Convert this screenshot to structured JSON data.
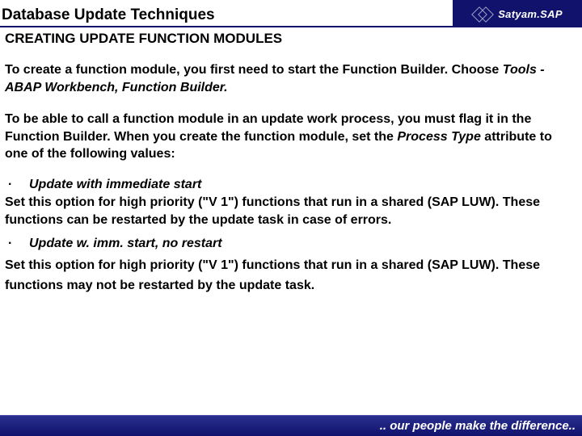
{
  "header": {
    "title": "Database Update Techniques",
    "brand": "Satyam.SAP"
  },
  "section_title": "CREATING UPDATE FUNCTION MODULES",
  "para1_a": "To create a function module, you first need to start the Function Builder. Choose ",
  "para1_b": "Tools - ABAP Workbench, Function Builder.",
  "para2_a": "To be able to call a function module in an update work process, you must flag it in the Function Builder. When you create the function module, set the ",
  "para2_b": "Process Type",
  "para2_c": " attribute to one of the following values:",
  "bullets": [
    {
      "title": "Update with immediate start",
      "desc": "Set this option for high priority (\"V 1\") functions that run in a shared (SAP LUW). These functions can be restarted by the update task in case of errors."
    },
    {
      "title": "Update w. imm. start, no restart",
      "desc": "Set this option for high priority (\"V 1\") functions that run in a shared (SAP LUW). These functions may not be restarted by the update task."
    }
  ],
  "footer": {
    "tagline": ".. our people make the difference.."
  }
}
